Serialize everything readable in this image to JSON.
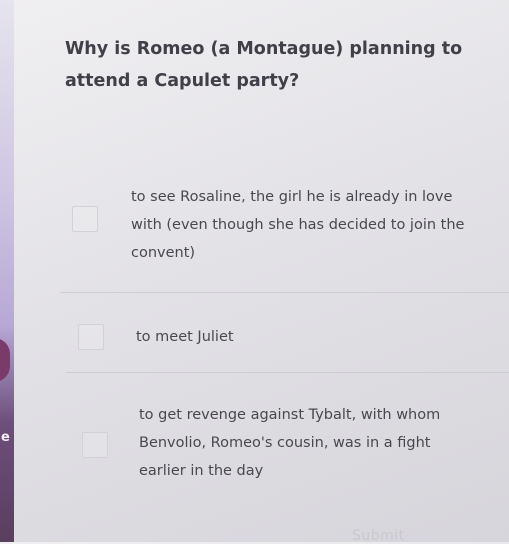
{
  "question": {
    "text": "Why is Romeo (a Montague) planning to attend a Capulet party?"
  },
  "options": [
    {
      "label": "to see Rosaline, the girl he is already in love with (even though she has decided to join the convent)"
    },
    {
      "label": "to meet Juliet"
    },
    {
      "label": "to get revenge against Tybalt, with whom Benvolio, Romeo's cousin, was in a fight earlier in the day"
    }
  ],
  "submit": {
    "label": "Submit"
  }
}
